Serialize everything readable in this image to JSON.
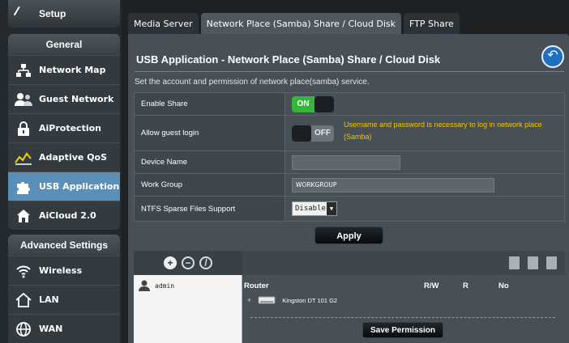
{
  "sidebar": {
    "setup_label": "Setup",
    "general_title": "General",
    "general_items": [
      {
        "label": "Network Map",
        "icon": "network-map-icon"
      },
      {
        "label": "Guest Network",
        "icon": "guest-network-icon"
      },
      {
        "label": "AiProtection",
        "icon": "lock-icon"
      },
      {
        "label": "Adaptive QoS",
        "icon": "qos-icon"
      },
      {
        "label": "USB Application",
        "icon": "puzzle-icon"
      },
      {
        "label": "AiCloud 2.0",
        "icon": "cloud-house-icon"
      }
    ],
    "active_item": "USB Application",
    "advanced_title": "Advanced Settings",
    "advanced_items": [
      {
        "label": "Wireless",
        "icon": "wifi-icon"
      },
      {
        "label": "LAN",
        "icon": "house-icon"
      },
      {
        "label": "WAN",
        "icon": "globe-icon"
      }
    ]
  },
  "tabs": [
    {
      "label": "Media Server"
    },
    {
      "label": "Network Place (Samba) Share / Cloud Disk",
      "active": true
    },
    {
      "label": "FTP Share"
    }
  ],
  "main": {
    "title": "USB Application - Network Place (Samba) Share / Cloud Disk",
    "description": "Set the account and permission of network place(samba) service.",
    "apply_label": "Apply"
  },
  "form": {
    "enable_share": {
      "label": "Enable Share",
      "state": "ON"
    },
    "allow_guest": {
      "label": "Allow guest login",
      "state": "OFF",
      "note": "Username and password is necessary to log in network place (Samba)"
    },
    "device_name": {
      "label": "Device Name",
      "value": ""
    },
    "work_group": {
      "label": "Work Group",
      "value": "WORKGROUP"
    },
    "ntfs_sparse": {
      "label": "NTFS Sparse Files Support",
      "value": "Disable"
    }
  },
  "permissions": {
    "user": "admin",
    "headers": {
      "router": "Router",
      "rw": "R/W",
      "r": "R",
      "no": "No"
    },
    "device": "Kingston DT 101 G2",
    "save_label": "Save Permission"
  },
  "colors": {
    "accent_active": "#5c8fb8",
    "toggle_on": "#35b53a",
    "note_text": "#f5c400"
  }
}
